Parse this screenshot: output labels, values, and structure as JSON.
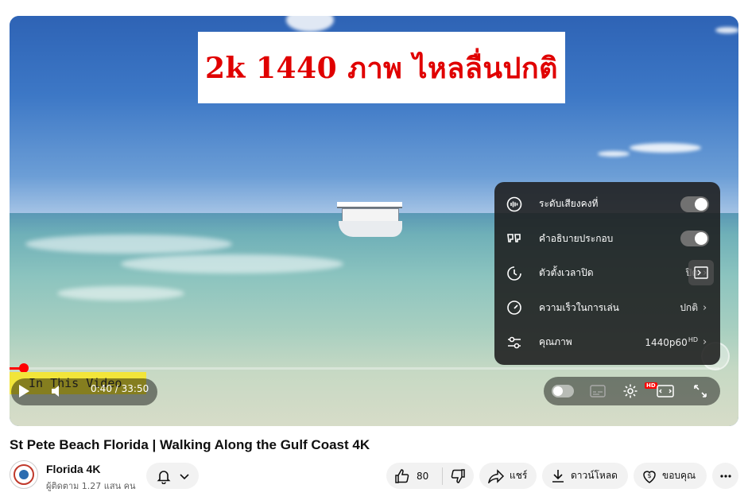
{
  "overlay_title": "2k 1440 ภาพ ไหลลื่นปกติ",
  "settings_menu": {
    "items": [
      {
        "icon": "stable-volume-icon",
        "label": "ระดับเสียงคงที่",
        "type": "toggle"
      },
      {
        "icon": "captions-icon",
        "label": "คำอธิบายประกอบ",
        "type": "toggle"
      },
      {
        "icon": "sleep-timer-icon",
        "label": "ตัวตั้งเวลาปิด",
        "value": "ปิด"
      },
      {
        "icon": "playback-speed-icon",
        "label": "ความเร็วในการเล่น",
        "value": "ปกติ"
      },
      {
        "icon": "quality-sliders-icon",
        "label": "คุณภาพ",
        "value": "1440p60",
        "badge": "HD"
      }
    ]
  },
  "player": {
    "chapter_label": "In This Video",
    "time_current": "0:40",
    "time_separator": " / ",
    "time_total": "33:50",
    "progress_fraction": 0.02,
    "settings_badge": "HD"
  },
  "video": {
    "title": "St Pete Beach Florida | Walking Along the Gulf Coast 4K"
  },
  "channel": {
    "name": "Florida 4K",
    "subscribers": "ผู้ติดตาม 1.27 แสน คน"
  },
  "actions": {
    "likes": "80",
    "share": "แชร์",
    "download": "ดาวน์โหลด",
    "thanks": "ขอบคุณ"
  },
  "colors": {
    "accent": "#ff0000",
    "banner_text": "#e00000",
    "chapter_chip": "#f2e53a"
  }
}
